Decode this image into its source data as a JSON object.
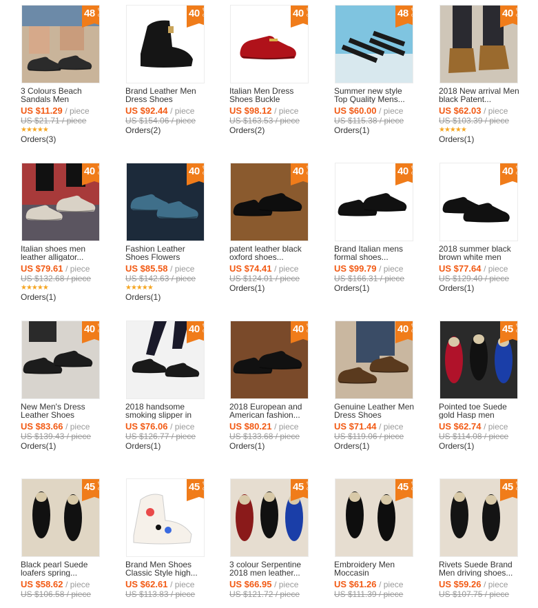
{
  "badge": {
    "off": "OFF",
    "pct_sign": "%"
  },
  "products": [
    {
      "title": "3 Colours Beach Sandals Men",
      "discount": "48",
      "price": "US $11.29",
      "unit": "/ piece",
      "orig": "US $21.71 / piece",
      "orders": "Orders(3)",
      "rated": true,
      "stars": "★★★★★",
      "kind": "sandal-legs",
      "bg": "#c9b49a",
      "shoe": "#2b2b2b"
    },
    {
      "title": "Brand Leather Men Dress Shoes",
      "discount": "40",
      "price": "US $92.44",
      "unit": "/ piece",
      "orig": "US $154.06 / piece",
      "orders": "Orders(2)",
      "rated": false,
      "kind": "boot",
      "bg": "#ffffff",
      "shoe": "#151515"
    },
    {
      "title": "Italian Men Dress Shoes Buckle",
      "discount": "40",
      "price": "US $98.12",
      "unit": "/ piece",
      "orig": "US $163.53 / piece",
      "orders": "Orders(2)",
      "rated": false,
      "kind": "loafer",
      "bg": "#ffffff",
      "shoe": "#b0121a"
    },
    {
      "title": "Summer new style Top Quality Mens...",
      "discount": "48",
      "price": "US $60.00",
      "unit": "/ piece",
      "orig": "US $115.38 / piece",
      "orders": "Orders(1)",
      "rated": false,
      "kind": "sandal",
      "bg": "#7fc4e0",
      "shoe": "#1a1a1a"
    },
    {
      "title": "2018 New arrival Men black Patent...",
      "discount": "40",
      "price": "US $62.03",
      "unit": "/ piece",
      "orig": "US $103.39 / piece",
      "orders": "Orders(1)",
      "rated": true,
      "stars": "★★★★★",
      "kind": "boots-legs",
      "bg": "#cfc6b8",
      "shoe": "#9a6a2e"
    },
    {
      "title": "Italian shoes men leather alligator...",
      "discount": "40",
      "price": "US $79.61",
      "unit": "/ piece",
      "orig": "US $132.68 / piece",
      "orders": "Orders(1)",
      "rated": true,
      "stars": "★★★★★",
      "kind": "snake-legs",
      "bg": "#5b5560",
      "shoe": "#d9d2c6"
    },
    {
      "title": "Fashion Leather Shoes Flowers",
      "discount": "40",
      "price": "US $85.58",
      "unit": "/ piece",
      "orig": "US $142.63 / piece",
      "orders": "Orders(1)",
      "rated": true,
      "stars": "★★★★★",
      "kind": "pattern-pair",
      "bg": "#1c2a3a",
      "shoe": "#3f6f8a"
    },
    {
      "title": "patent leather black oxford shoes...",
      "discount": "40",
      "price": "US $74.41",
      "unit": "/ piece",
      "orig": "US $124.01 / piece",
      "orders": "Orders(1)",
      "rated": false,
      "kind": "oxford-pair",
      "bg": "#8a5a2e",
      "shoe": "#0e0e0e"
    },
    {
      "title": "Brand Italian mens formal shoes...",
      "discount": "40",
      "price": "US $99.79",
      "unit": "/ piece",
      "orig": "US $166.31 / piece",
      "orders": "Orders(1)",
      "rated": false,
      "kind": "oxford-pair",
      "bg": "#ffffff",
      "shoe": "#111111"
    },
    {
      "title": "2018 summer black brown white men",
      "discount": "40",
      "price": "US $77.64",
      "unit": "/ piece",
      "orig": "US $129.40 / piece",
      "orders": "Orders(1)",
      "rated": false,
      "kind": "slip-pair",
      "bg": "#ffffff",
      "shoe": "#111111"
    },
    {
      "title": "New Men's Dress Leather Shoes",
      "discount": "40",
      "price": "US $83.66",
      "unit": "/ piece",
      "orig": "US $139.43 / piece",
      "orders": "Orders(1)",
      "rated": false,
      "kind": "hand-pair",
      "bg": "#d8d4ce",
      "shoe": "#1c1c1c"
    },
    {
      "title": "2018 handsome smoking slipper in",
      "discount": "40",
      "price": "US $76.06",
      "unit": "/ piece",
      "orig": "US $126.77 / piece",
      "orders": "Orders(1)",
      "rated": false,
      "kind": "walk-legs",
      "bg": "#f2f2f2",
      "shoe": "#1a1a1a"
    },
    {
      "title": "2018 European and American fashion...",
      "discount": "40",
      "price": "US $80.21",
      "unit": "/ piece",
      "orig": "US $133.68 / piece",
      "orders": "Orders(1)",
      "rated": false,
      "kind": "oxford-pair",
      "bg": "#7a4a2a",
      "shoe": "#111111"
    },
    {
      "title": "Genuine Leather Men Dress Shoes",
      "discount": "40",
      "price": "US $71.44",
      "unit": "/ piece",
      "orig": "US $119.06 / piece",
      "orders": "Orders(1)",
      "rated": false,
      "kind": "jeans-legs",
      "bg": "#c9b7a0",
      "shoe": "#5a3a1e"
    },
    {
      "title": "Pointed toe Suede gold Hasp men",
      "discount": "45",
      "price": "US $62.74",
      "unit": "/ piece",
      "orig": "US $114.08 / piece",
      "orders": "Orders(1)",
      "rated": false,
      "kind": "triple",
      "bg": "#2a2a2a",
      "shoe": "#b0122a"
    },
    {
      "title": "Black pearl Suede loafers spring...",
      "discount": "45",
      "price": "US $58.62",
      "unit": "/ piece",
      "orig": "US $106.58 / piece",
      "orders": "",
      "rated": false,
      "kind": "top-pair",
      "bg": "#e0d6c4",
      "shoe": "#111111"
    },
    {
      "title": "Brand Men Shoes Classic Style high...",
      "discount": "45",
      "price": "US $62.61",
      "unit": "/ piece",
      "orig": "US $113.83 / piece",
      "orders": "",
      "rated": false,
      "kind": "hightop",
      "bg": "#ffffff",
      "shoe": "#e94a4a"
    },
    {
      "title": "3 colour Serpentine 2018 men leather...",
      "discount": "45",
      "price": "US $66.95",
      "unit": "/ piece",
      "orig": "US $121.72 / piece",
      "orders": "",
      "rated": false,
      "kind": "triple",
      "bg": "#e6ddd0",
      "shoe": "#8a1a1a"
    },
    {
      "title": "Embroidery Men Moccasin",
      "discount": "45",
      "price": "US $61.26",
      "unit": "/ piece",
      "orig": "US $111.39 / piece",
      "orders": "",
      "rated": false,
      "kind": "top-pair",
      "bg": "#e6ddd0",
      "shoe": "#0e0e0e"
    },
    {
      "title": "Rivets Suede Brand Men driving shoes...",
      "discount": "45",
      "price": "US $59.26",
      "unit": "/ piece",
      "orig": "US $107.75 / piece",
      "orders": "",
      "rated": false,
      "kind": "top-pair",
      "bg": "#e6ddd0",
      "shoe": "#141414"
    }
  ]
}
